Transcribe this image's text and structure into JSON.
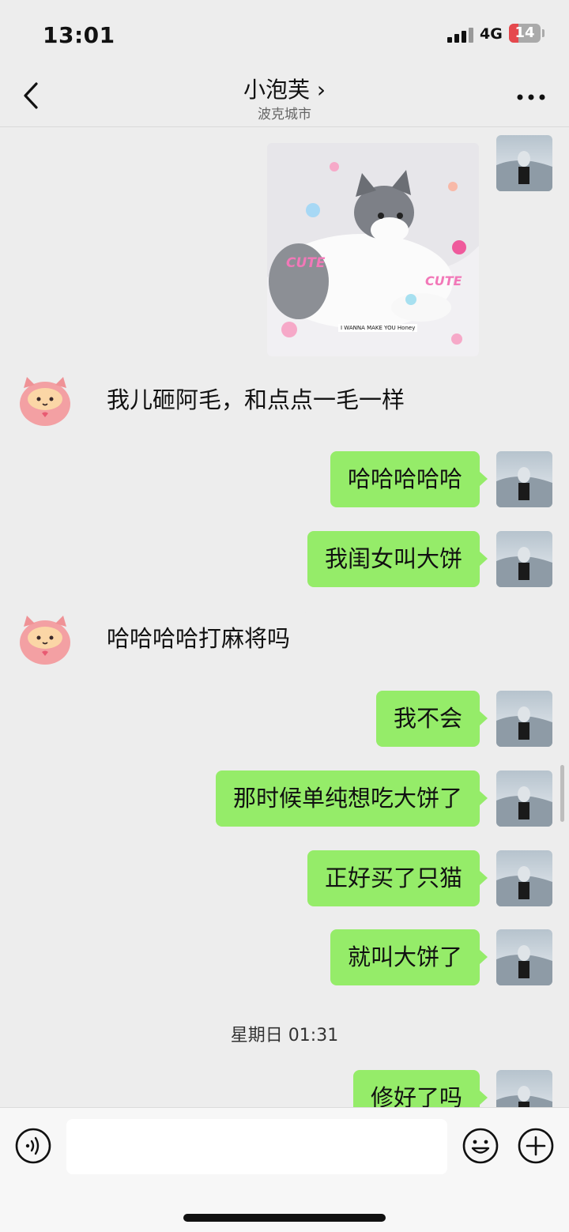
{
  "status": {
    "time": "13:01",
    "network": "4G",
    "battery": "14"
  },
  "nav": {
    "title": "小泡芙 ›",
    "subtitle": "波克城市"
  },
  "image_message": {
    "caption": "I WANNA MAKE YOU Honey",
    "stickers": [
      "CUTE",
      "CUTE"
    ]
  },
  "messages": [
    {
      "from": "other",
      "text": "我儿砸阿毛，和点点一毛一样"
    },
    {
      "from": "me",
      "text": "哈哈哈哈哈"
    },
    {
      "from": "me",
      "text": "我闺女叫大饼"
    },
    {
      "from": "other",
      "text": "哈哈哈哈打麻将吗"
    },
    {
      "from": "me",
      "text": "我不会"
    },
    {
      "from": "me",
      "text": "那时候单纯想吃大饼了"
    },
    {
      "from": "me",
      "text": "正好买了只猫"
    },
    {
      "from": "me",
      "text": "就叫大饼了"
    },
    {
      "from": "me",
      "text": "修好了吗"
    }
  ],
  "timestamp": "星期日 01:31",
  "input": {
    "value": "",
    "placeholder": ""
  },
  "icons": {
    "back": "chevron-left-icon",
    "more": "more-dots-icon",
    "voice": "voice-icon",
    "emoji": "emoji-icon",
    "plus": "plus-icon"
  },
  "colors": {
    "bubble_me": "#95ec69",
    "background": "#ededed"
  }
}
